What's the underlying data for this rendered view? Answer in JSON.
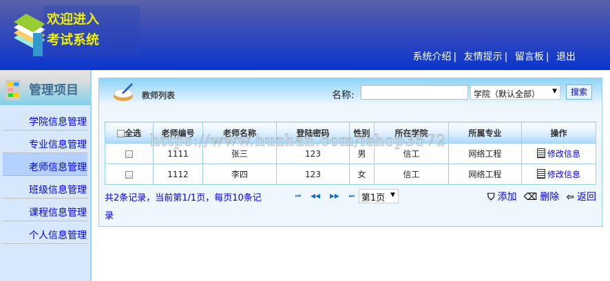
{
  "header": {
    "logo_line1": "欢迎进入",
    "logo_line2": "考试系统",
    "nav": [
      "系统介绍",
      "友情提示",
      "留言板",
      "退出"
    ],
    "sep": "|"
  },
  "sidebar": {
    "title": "管理项目",
    "items": [
      {
        "label": "学院信息管理"
      },
      {
        "label": "专业信息管理"
      },
      {
        "label": "老师信息管理",
        "active": true
      },
      {
        "label": "班级信息管理"
      },
      {
        "label": "课程信息管理"
      },
      {
        "label": "个人信息管理"
      }
    ]
  },
  "panel": {
    "title": "教师列表",
    "search_label": "名称:",
    "search_value": "",
    "college_select": "学院（默认全部）",
    "search_button": "搜索"
  },
  "table": {
    "select_all": "全选",
    "headers": [
      "老师编号",
      "老师名称",
      "登陆密码",
      "性别",
      "所在学院",
      "所属专业",
      "操作"
    ],
    "rows": [
      [
        "1111",
        "张三",
        "123",
        "男",
        "信工",
        "网络工程",
        "修改信息"
      ],
      [
        "1112",
        "李四",
        "123",
        "女",
        "信工",
        "网络工程",
        "修改信息"
      ]
    ]
  },
  "footer": {
    "info": "共2条记录，当前第1/1页，每页10条记录",
    "pager": [
      "⏮",
      "◀◀",
      "▶▶",
      "⏭"
    ],
    "page_select": "第1页",
    "actions": [
      "添加",
      "删除",
      "返回"
    ]
  },
  "watermark": "https://www.huzhan.com/ishop3572"
}
